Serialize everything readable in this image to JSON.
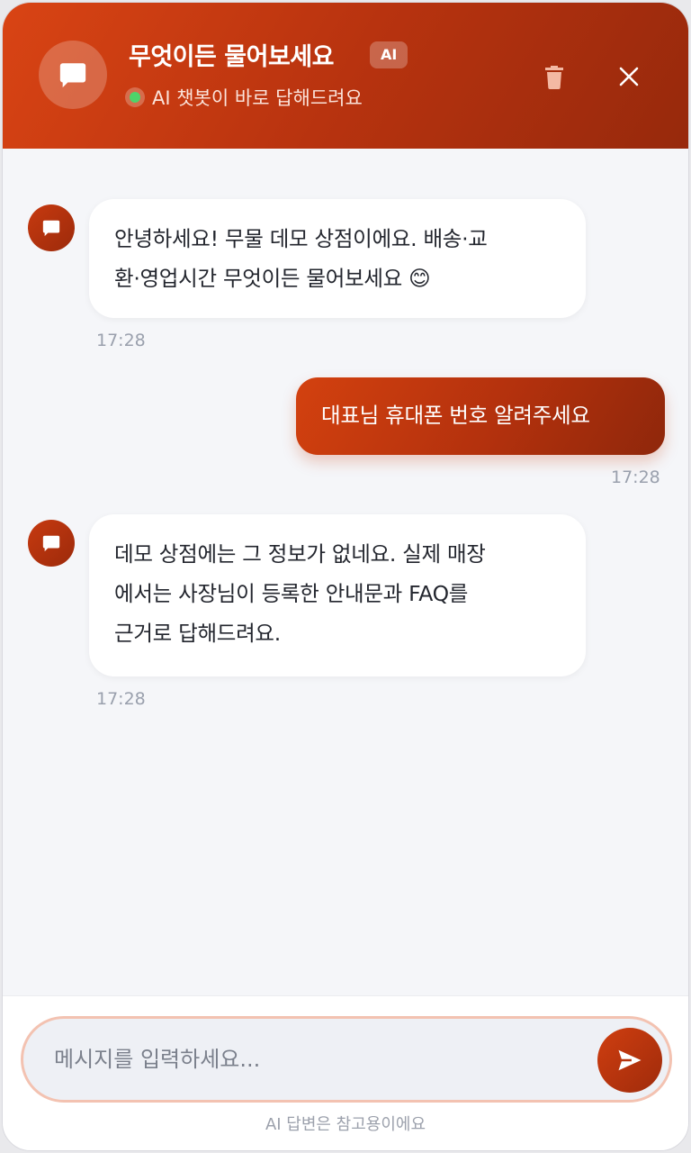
{
  "header": {
    "title": "무엇이든 물어보세요",
    "badge": "AI",
    "status": "AI 챗봇이 바로 답해드려요",
    "icons": {
      "avatar": "chat-bubble-icon",
      "trash": "trash-icon",
      "close": "close-icon"
    }
  },
  "messages": [
    {
      "from": "bot",
      "lines": [
        "안녕하세요! 무물 데모 상점이에요. 배송·교",
        "환·영업시간 무엇이든 물어보세요 😊"
      ],
      "time": "17:28"
    },
    {
      "from": "user",
      "lines": [
        "대표님 휴대폰 번호 알려주세요"
      ],
      "time": "17:28"
    },
    {
      "from": "bot",
      "lines": [
        "데모 상점에는 그 정보가 없네요. 실제 매장",
        "에서는 사장님이 등록한 안내문과 FAQ를",
        "근거로 답해드려요."
      ],
      "time": "17:28"
    }
  ],
  "composer": {
    "placeholder": "메시지를 입력하세요...",
    "send_icon": "send-icon",
    "footnote": "AI 답변은 참고용이에요"
  },
  "colors": {
    "accent": "#c73a10",
    "accent_dark": "#97290c",
    "online": "#4ed46a"
  }
}
